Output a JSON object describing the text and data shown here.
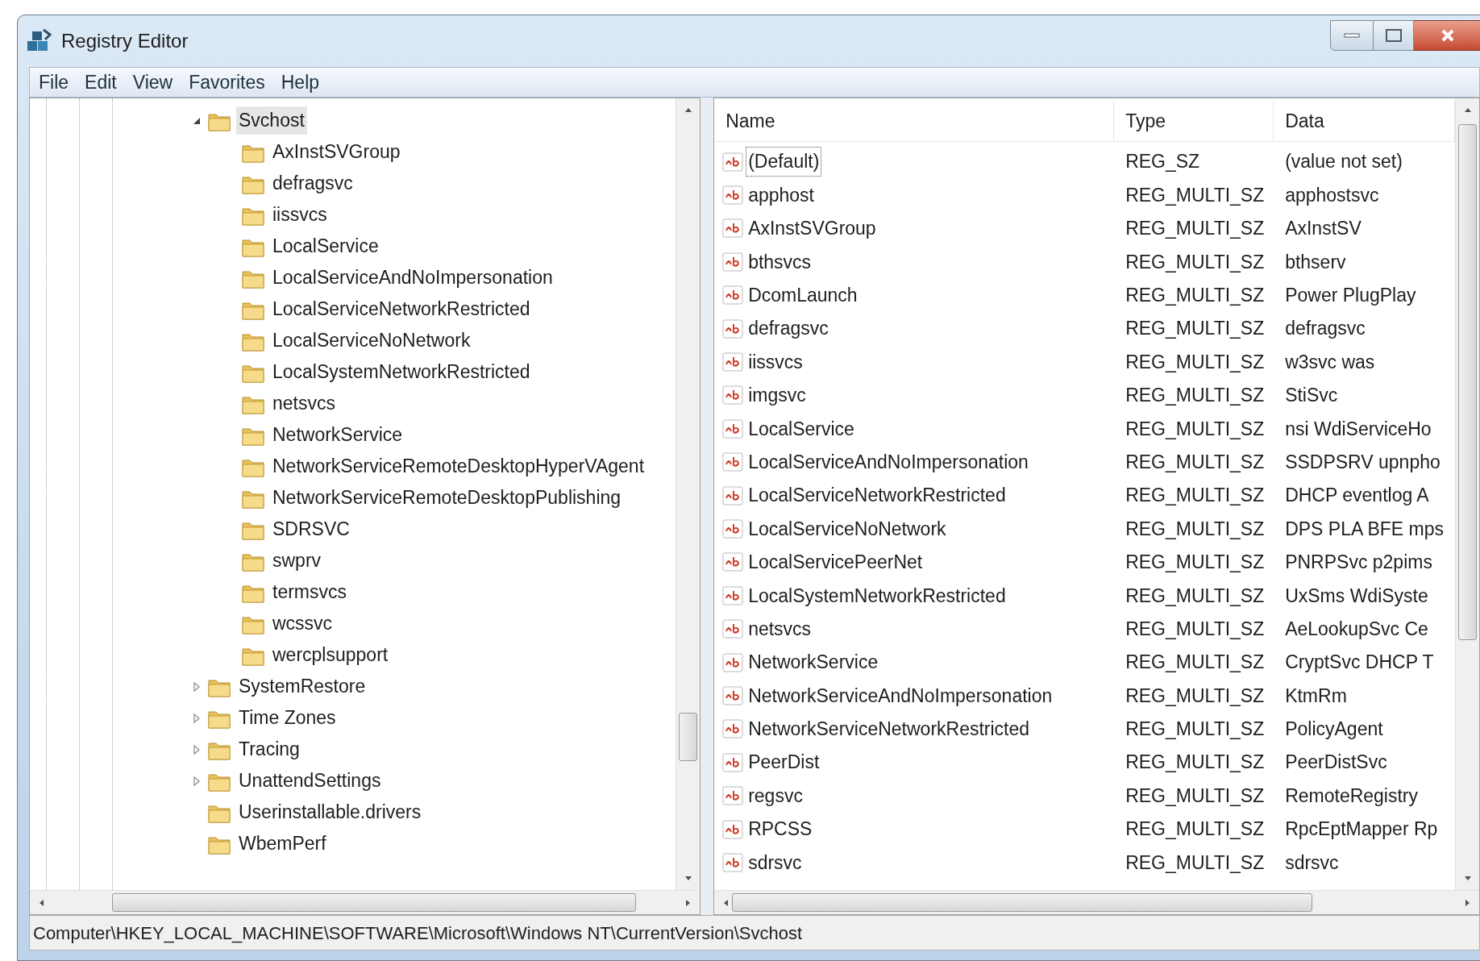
{
  "window": {
    "title": "Registry Editor"
  },
  "menu": [
    "File",
    "Edit",
    "View",
    "Favorites",
    "Help"
  ],
  "tree": [
    {
      "label": "Svchost",
      "kind": "branch",
      "expanded": true,
      "selected": true,
      "children": [
        {
          "label": "AxInstSVGroup",
          "kind": "leaf",
          "selected": false
        },
        {
          "label": "defragsvc",
          "kind": "leaf",
          "selected": false
        },
        {
          "label": "iissvcs",
          "kind": "leaf",
          "selected": false
        },
        {
          "label": "LocalService",
          "kind": "leaf",
          "selected": false
        },
        {
          "label": "LocalServiceAndNoImpersonation",
          "kind": "leaf",
          "selected": false
        },
        {
          "label": "LocalServiceNetworkRestricted",
          "kind": "leaf",
          "selected": false
        },
        {
          "label": "LocalServiceNoNetwork",
          "kind": "leaf",
          "selected": false
        },
        {
          "label": "LocalSystemNetworkRestricted",
          "kind": "leaf",
          "selected": false
        },
        {
          "label": "netsvcs",
          "kind": "leaf",
          "selected": false
        },
        {
          "label": "NetworkService",
          "kind": "leaf",
          "selected": false
        },
        {
          "label": "NetworkServiceRemoteDesktopHyperVAgent",
          "kind": "leaf",
          "selected": false
        },
        {
          "label": "NetworkServiceRemoteDesktopPublishing",
          "kind": "leaf",
          "selected": false
        },
        {
          "label": "SDRSVC",
          "kind": "leaf",
          "selected": false
        },
        {
          "label": "swprv",
          "kind": "leaf",
          "selected": false
        },
        {
          "label": "termsvcs",
          "kind": "leaf",
          "selected": false
        },
        {
          "label": "wcssvc",
          "kind": "leaf",
          "selected": false
        },
        {
          "label": "wercplsupport",
          "kind": "leaf",
          "selected": false
        }
      ]
    },
    {
      "label": "SystemRestore",
      "kind": "branch",
      "expanded": false,
      "selected": false
    },
    {
      "label": "Time Zones",
      "kind": "branch",
      "expanded": false,
      "selected": false
    },
    {
      "label": "Tracing",
      "kind": "branch",
      "expanded": false,
      "selected": false
    },
    {
      "label": "UnattendSettings",
      "kind": "branch",
      "expanded": false,
      "selected": false
    },
    {
      "label": "Userinstallable.drivers",
      "kind": "leaf",
      "selected": false
    },
    {
      "label": "WbemPerf",
      "kind": "leaf",
      "selected": false
    }
  ],
  "values": {
    "columns": [
      "Name",
      "Type",
      "Data"
    ],
    "rows": [
      {
        "name": "(Default)",
        "type": "REG_SZ",
        "data": "(value not set)",
        "selected": true
      },
      {
        "name": "apphost",
        "type": "REG_MULTI_SZ",
        "data": "apphostsvc",
        "selected": false
      },
      {
        "name": "AxInstSVGroup",
        "type": "REG_MULTI_SZ",
        "data": "AxInstSV",
        "selected": false
      },
      {
        "name": "bthsvcs",
        "type": "REG_MULTI_SZ",
        "data": "bthserv",
        "selected": false
      },
      {
        "name": "DcomLaunch",
        "type": "REG_MULTI_SZ",
        "data": "Power PlugPlay",
        "selected": false
      },
      {
        "name": "defragsvc",
        "type": "REG_MULTI_SZ",
        "data": "defragsvc",
        "selected": false
      },
      {
        "name": "iissvcs",
        "type": "REG_MULTI_SZ",
        "data": "w3svc was",
        "selected": false
      },
      {
        "name": "imgsvc",
        "type": "REG_MULTI_SZ",
        "data": "StiSvc",
        "selected": false
      },
      {
        "name": "LocalService",
        "type": "REG_MULTI_SZ",
        "data": "nsi WdiServiceHo",
        "selected": false
      },
      {
        "name": "LocalServiceAndNoImpersonation",
        "type": "REG_MULTI_SZ",
        "data": "SSDPSRV upnpho",
        "selected": false
      },
      {
        "name": "LocalServiceNetworkRestricted",
        "type": "REG_MULTI_SZ",
        "data": "DHCP eventlog A",
        "selected": false
      },
      {
        "name": "LocalServiceNoNetwork",
        "type": "REG_MULTI_SZ",
        "data": "DPS PLA BFE mps",
        "selected": false
      },
      {
        "name": "LocalServicePeerNet",
        "type": "REG_MULTI_SZ",
        "data": "PNRPSvc p2pims",
        "selected": false
      },
      {
        "name": "LocalSystemNetworkRestricted",
        "type": "REG_MULTI_SZ",
        "data": "UxSms WdiSyste",
        "selected": false
      },
      {
        "name": "netsvcs",
        "type": "REG_MULTI_SZ",
        "data": "AeLookupSvc Ce",
        "selected": false
      },
      {
        "name": "NetworkService",
        "type": "REG_MULTI_SZ",
        "data": "CryptSvc DHCP T",
        "selected": false
      },
      {
        "name": "NetworkServiceAndNoImpersonation",
        "type": "REG_MULTI_SZ",
        "data": "KtmRm",
        "selected": false
      },
      {
        "name": "NetworkServiceNetworkRestricted",
        "type": "REG_MULTI_SZ",
        "data": "PolicyAgent",
        "selected": false
      },
      {
        "name": "PeerDist",
        "type": "REG_MULTI_SZ",
        "data": "PeerDistSvc",
        "selected": false
      },
      {
        "name": "regsvc",
        "type": "REG_MULTI_SZ",
        "data": "RemoteRegistry",
        "selected": false
      },
      {
        "name": "RPCSS",
        "type": "REG_MULTI_SZ",
        "data": "RpcEptMapper Rp",
        "selected": false
      },
      {
        "name": "sdrsvc",
        "type": "REG_MULTI_SZ",
        "data": "sdrsvc",
        "selected": false
      }
    ]
  },
  "status_bar": "Computer\\HKEY_LOCAL_MACHINE\\SOFTWARE\\Microsoft\\Windows NT\\CurrentVersion\\Svchost"
}
